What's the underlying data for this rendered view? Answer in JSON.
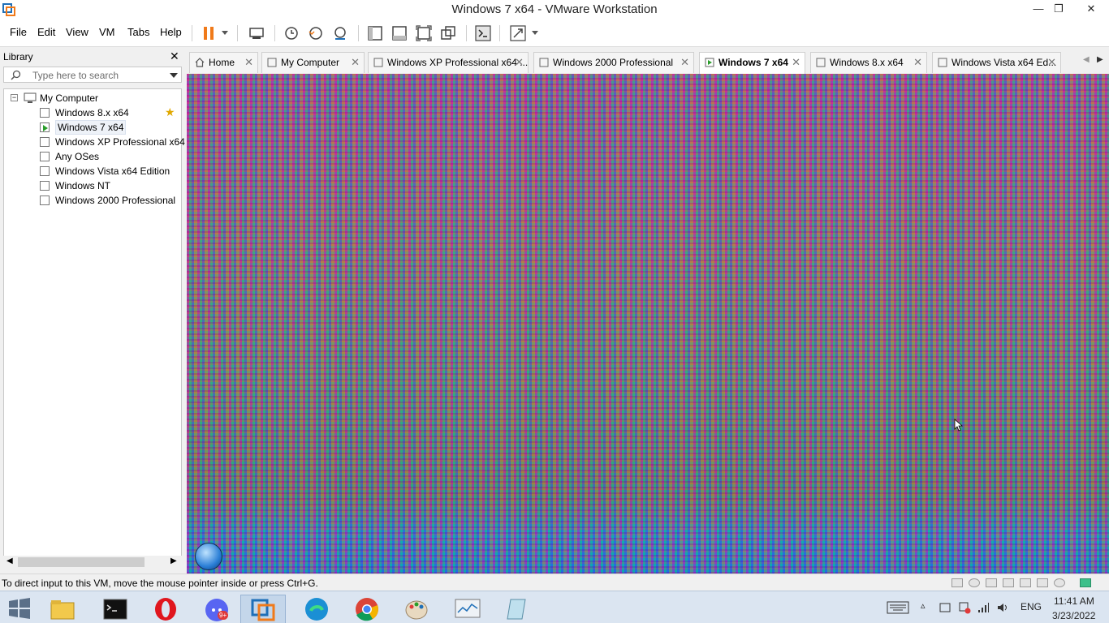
{
  "window": {
    "title": "Windows 7 x64 - VMware Workstation",
    "minimize": "—",
    "restore": "❐",
    "close": "✕"
  },
  "menu": [
    "File",
    "Edit",
    "View",
    "VM",
    "Tabs",
    "Help"
  ],
  "library": {
    "title": "Library",
    "close": "✕",
    "search_placeholder": "Type here to search",
    "root": "My Computer",
    "items": [
      "Windows 8.x x64",
      "Windows 7 x64",
      "Windows XP Professional x64",
      "Any OSes",
      "Windows Vista x64 Edition",
      "Windows NT",
      "Windows 2000 Professional"
    ]
  },
  "tabs": [
    {
      "label": "Home",
      "close": "✕"
    },
    {
      "label": "My Computer",
      "close": "✕"
    },
    {
      "label": "Windows XP Professional x64 ...",
      "close": "✕"
    },
    {
      "label": "Windows 2000 Professional",
      "close": "✕"
    },
    {
      "label": "Windows 7 x64",
      "close": "✕"
    },
    {
      "label": "Windows 8.x x64",
      "close": "✕"
    },
    {
      "label": "Windows Vista x64 Ed...",
      "close": "✕"
    }
  ],
  "tab_nav": {
    "prev": "◀",
    "next": "▶"
  },
  "status": {
    "message": "To direct input to this VM, move the mouse pointer inside or press Ctrl+G."
  },
  "tray": {
    "language": "ENG",
    "time": "11:41 AM",
    "date": "3/23/2022",
    "discord_badge": "9+"
  },
  "colors": {
    "accent_orange": "#f07a1a",
    "vmware_blue": "#1e6fb8",
    "taskbar": "#dbe5f1"
  }
}
